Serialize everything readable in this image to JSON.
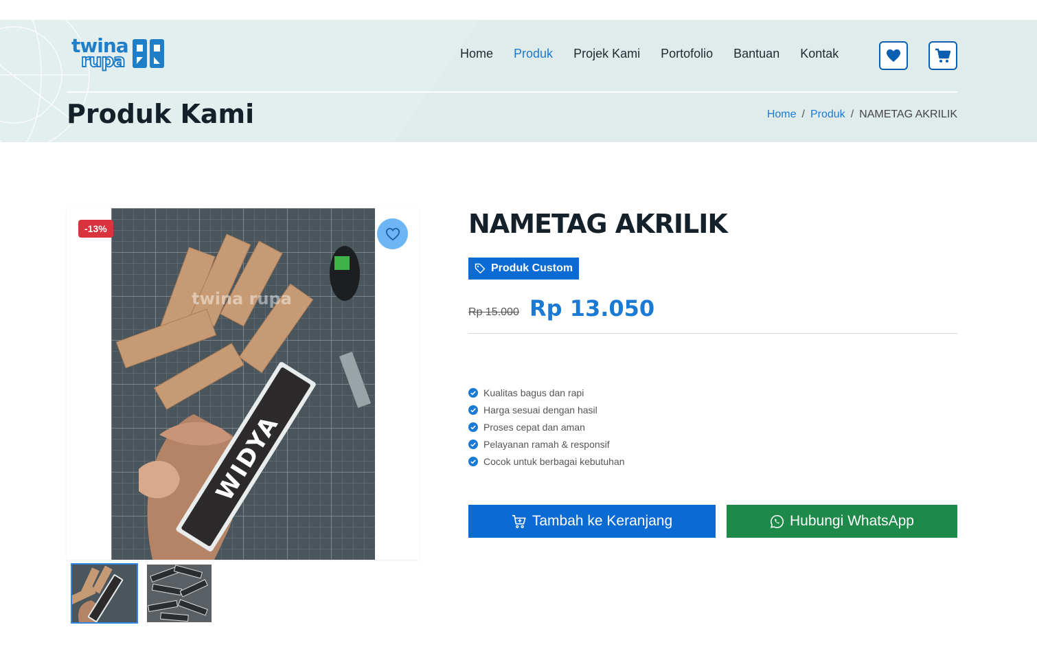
{
  "brand": {
    "logo_line1": "twina",
    "logo_line2": "rupa"
  },
  "nav": {
    "items": [
      {
        "label": "Home",
        "active": false
      },
      {
        "label": "Produk",
        "active": true
      },
      {
        "label": "Projek Kami",
        "active": false
      },
      {
        "label": "Portofolio",
        "active": false
      },
      {
        "label": "Bantuan",
        "active": false
      },
      {
        "label": "Kontak",
        "active": false
      }
    ],
    "wishlist_icon": "heart-icon",
    "cart_icon": "cart-icon"
  },
  "page": {
    "title": "Produk Kami"
  },
  "breadcrumb": {
    "home": "Home",
    "category": "Produk",
    "current": "NAMETAG AKRILIK"
  },
  "product": {
    "name": "NAMETAG AKRILIK",
    "tag": "Produk Custom",
    "discount_badge": "-13%",
    "old_price": "Rp 15.000",
    "price": "Rp 13.050",
    "photo_text": "WIDYA",
    "watermark": "twina rupa",
    "features": [
      "Kualitas bagus dan rapi",
      "Harga sesuai dengan hasil",
      "Proses cepat dan aman",
      "Pelayanan ramah & responsif",
      "Cocok untuk berbagai kebutuhan"
    ],
    "thumbnail_count": 2
  },
  "actions": {
    "add_to_cart": "Tambah ke Keranjang",
    "whatsapp": "Hubungi WhatsApp"
  },
  "colors": {
    "primary": "#0b6bd4",
    "link": "#1a7ad4",
    "discount": "#d9343d",
    "whatsapp": "#1d8a4a",
    "header_bg": "#e3eeee"
  }
}
